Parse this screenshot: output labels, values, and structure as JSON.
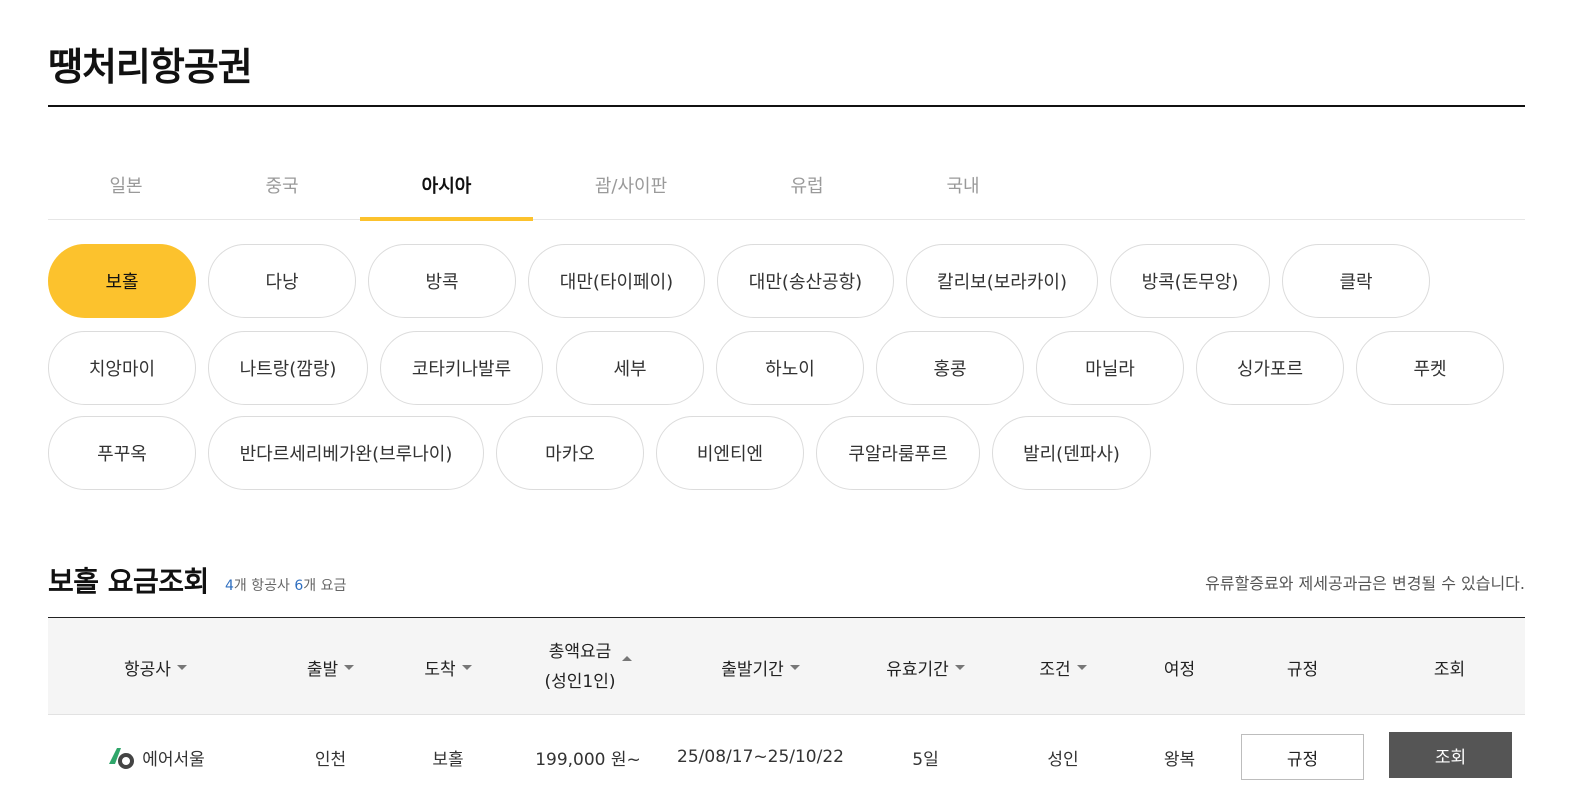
{
  "page": {
    "title": "땡처리항공권"
  },
  "tabs": [
    {
      "label": "일본"
    },
    {
      "label": "중국"
    },
    {
      "label": "아시아",
      "active": true
    },
    {
      "label": "괌/사이판"
    },
    {
      "label": "유럽"
    },
    {
      "label": "국내"
    }
  ],
  "destinations": [
    "보홀",
    "다낭",
    "방콕",
    "대만(타이페이)",
    "대만(송산공항)",
    "칼리보(보라카이)",
    "방콕(돈무앙)",
    "클락",
    "치앙마이",
    "나트랑(깜랑)",
    "코타키나발루",
    "세부",
    "하노이",
    "홍콩",
    "마닐라",
    "싱가포르",
    "푸켓",
    "푸꾸옥",
    "반다르세리베가완(브루나이)",
    "마카오",
    "비엔티엔",
    "쿠알라룸푸르",
    "발리(덴파사)"
  ],
  "selected_destination": "보홀",
  "section": {
    "title": "보홀 요금조회",
    "airline_count": "4",
    "airline_count_suffix": "개 항공사",
    "fare_count": "6",
    "fare_count_suffix": "개 요금",
    "note": "유류할증료와 제세공과금은 변경될 수 있습니다."
  },
  "table": {
    "headers": {
      "airline": "항공사",
      "departure": "출발",
      "arrival": "도착",
      "total_line1": "총액요금",
      "total_line2": "(성인1인)",
      "period": "출발기간",
      "validity": "유효기간",
      "condition": "조건",
      "trip": "여정",
      "rule": "규정",
      "view": "조회"
    },
    "rows": [
      {
        "airline": "에어서울",
        "departure": "인천",
        "arrival": "보홀",
        "total": "199,000 원~",
        "period": "25/08/17~25/10/22",
        "validity": "5일",
        "condition": "성인",
        "trip": "왕복",
        "rule_button": "규정",
        "view_button": "조회"
      }
    ]
  },
  "colors": {
    "accent": "#fcc22d",
    "count_blue": "#2f6fc0",
    "view_button": "#555555"
  }
}
